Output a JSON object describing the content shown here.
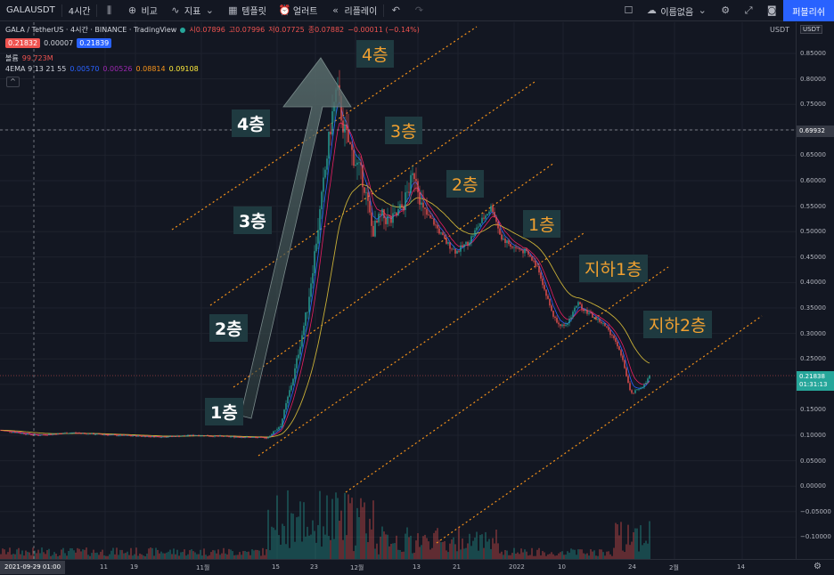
{
  "toolbar": {
    "symbol": "GALAUSDT",
    "interval": "4시간",
    "compare": "비교",
    "indicators": "지표",
    "templates": "템플릿",
    "alert": "얼러트",
    "replay": "리플레이",
    "layout_name": "이름없음",
    "publish": "퍼블리쉬"
  },
  "legend": {
    "title": "GALA / TetherUS · 4시간 · BINANCE · TradingView",
    "open": "시0.07896",
    "high": "고0.07996",
    "low": "저0.07725",
    "close": "종0.07882",
    "change": "−0.00011 (−0.14%)",
    "bid": "0.21832",
    "spread": "0.00007",
    "ask": "0.21839",
    "volume_label": "볼륨",
    "volume_value": "99.723M",
    "ema_label": "4EMA 9 13 21 55",
    "ema1": "0.00570",
    "ema2": "0.00526",
    "ema3": "0.08814",
    "ema4": "0.09108",
    "collapse": "^"
  },
  "annotations": {
    "white_1": "1층",
    "white_2": "2층",
    "white_3": "3층",
    "white_4": "4층",
    "orange_4": "4층",
    "orange_3": "3층",
    "orange_2": "2층",
    "orange_1": "1층",
    "orange_b1": "지하1층",
    "orange_b2": "지하2층"
  },
  "price_axis": {
    "currency": "USDT",
    "labels": [
      "0.85000",
      "0.80000",
      "0.75000",
      "0.70000",
      "0.65000",
      "0.60000",
      "0.55000",
      "0.50000",
      "0.45000",
      "0.40000",
      "0.35000",
      "0.30000",
      "0.25000",
      "0.20000",
      "0.15000",
      "0.10000",
      "0.05000",
      "0.00000",
      "−0.05000",
      "−0.10000"
    ],
    "crosshair_price": "0.69932",
    "last_price": "0.21838",
    "countdown": "01:31:13"
  },
  "time_axis": {
    "crosshair_date": "2021-09-29 01:00",
    "labels": [
      "11",
      "19",
      "11월",
      "15",
      "23",
      "12월",
      "13",
      "21",
      "2022",
      "10",
      "24",
      "2월",
      "14"
    ]
  },
  "colors": {
    "up": "#26a69a",
    "down": "#ef5350",
    "accent": "#2962ff",
    "channel": "#f7931a",
    "ema_slow": "#c9b037"
  }
}
